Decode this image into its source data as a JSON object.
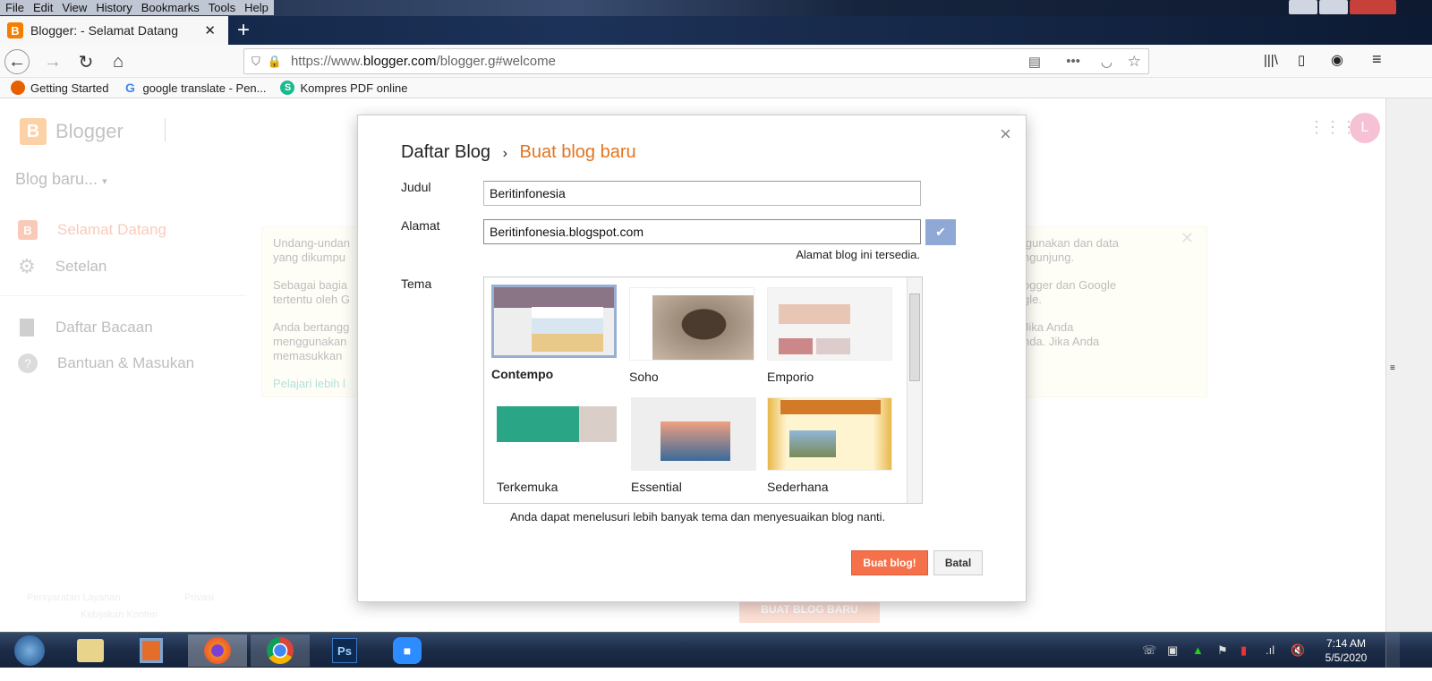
{
  "menu": [
    "File",
    "Edit",
    "View",
    "History",
    "Bookmarks",
    "Tools",
    "Help"
  ],
  "tab": {
    "title": "Blogger: - Selamat Datang",
    "close": "✕",
    "new": "+"
  },
  "url": {
    "prefix": "https://www.",
    "domain": "blogger.com",
    "path": "/blogger.g#welcome"
  },
  "bookmarks": [
    "Getting Started",
    "google translate - Pen...",
    "Kompres PDF online"
  ],
  "blogger": {
    "logo": "Blogger",
    "blog_select": "Blog baru...",
    "avatar": "L",
    "nav": [
      "Selamat Datang",
      "Setelan",
      "Daftar Bacaan",
      "Bantuan & Masukan"
    ],
    "notice": {
      "left": [
        "Undang-undan",
        "yang dikumpu",
        "Sebagai bagia",
        "tertentu oleh G",
        "Anda bertangg",
        "menggunakan",
        "memasukkan"
      ],
      "link": "Pelajari lebih l",
      "right": [
        "igunakan dan data",
        "ngunjung.",
        "ogger dan Google",
        "gle.",
        "Jika Anda",
        "nda. Jika Anda"
      ]
    },
    "footer": [
      "Persyaratan Layanan",
      "Privasi",
      "Kebijakan Konten"
    ],
    "create_button": "BUAT BLOG BARU"
  },
  "dialog": {
    "crumb": "Daftar Blog",
    "sep": "›",
    "title": "Buat blog baru",
    "close": "×",
    "judul_label": "Judul",
    "judul_value": "Beritinfonesia",
    "alamat_label": "Alamat",
    "alamat_value": "Beritinfonesia.blogspot.com",
    "alamat_status": "Alamat blog ini tersedia.",
    "tema_label": "Tema",
    "themes": [
      "Contempo",
      "Soho",
      "Emporio",
      "Terkemuka",
      "Essential",
      "Sederhana"
    ],
    "selected_theme": "Contempo",
    "hint": "Anda dapat menelusuri lebih banyak tema dan menyesuaikan blog nanti.",
    "create": "Buat blog!",
    "cancel": "Batal"
  },
  "clock": {
    "time": "7:14 AM",
    "date": "5/5/2020"
  },
  "taskbar": {
    "ps": "Ps"
  }
}
